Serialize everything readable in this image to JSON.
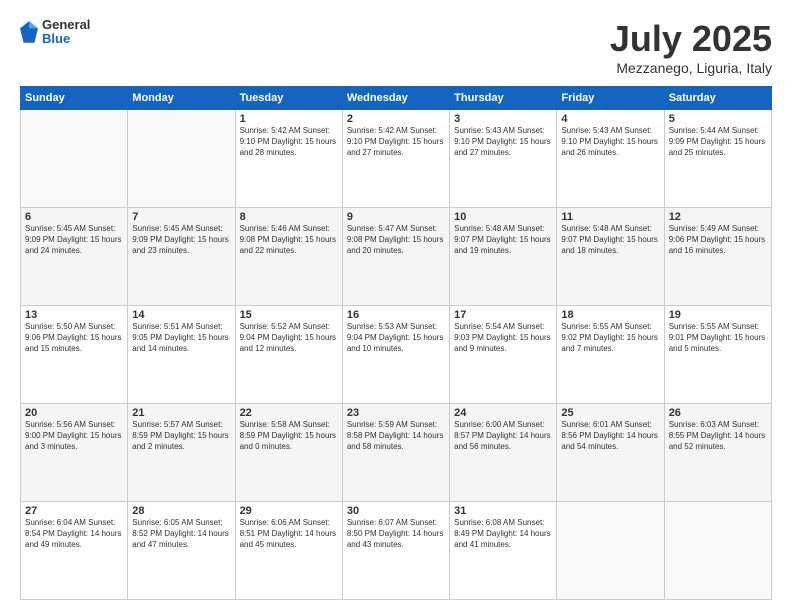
{
  "header": {
    "logo_general": "General",
    "logo_blue": "Blue",
    "title": "July 2025",
    "location": "Mezzanego, Liguria, Italy"
  },
  "days_of_week": [
    "Sunday",
    "Monday",
    "Tuesday",
    "Wednesday",
    "Thursday",
    "Friday",
    "Saturday"
  ],
  "weeks": [
    [
      {
        "day": "",
        "info": ""
      },
      {
        "day": "",
        "info": ""
      },
      {
        "day": "1",
        "info": "Sunrise: 5:42 AM\nSunset: 9:10 PM\nDaylight: 15 hours\nand 28 minutes."
      },
      {
        "day": "2",
        "info": "Sunrise: 5:42 AM\nSunset: 9:10 PM\nDaylight: 15 hours\nand 27 minutes."
      },
      {
        "day": "3",
        "info": "Sunrise: 5:43 AM\nSunset: 9:10 PM\nDaylight: 15 hours\nand 27 minutes."
      },
      {
        "day": "4",
        "info": "Sunrise: 5:43 AM\nSunset: 9:10 PM\nDaylight: 15 hours\nand 26 minutes."
      },
      {
        "day": "5",
        "info": "Sunrise: 5:44 AM\nSunset: 9:09 PM\nDaylight: 15 hours\nand 25 minutes."
      }
    ],
    [
      {
        "day": "6",
        "info": "Sunrise: 5:45 AM\nSunset: 9:09 PM\nDaylight: 15 hours\nand 24 minutes."
      },
      {
        "day": "7",
        "info": "Sunrise: 5:45 AM\nSunset: 9:09 PM\nDaylight: 15 hours\nand 23 minutes."
      },
      {
        "day": "8",
        "info": "Sunrise: 5:46 AM\nSunset: 9:08 PM\nDaylight: 15 hours\nand 22 minutes."
      },
      {
        "day": "9",
        "info": "Sunrise: 5:47 AM\nSunset: 9:08 PM\nDaylight: 15 hours\nand 20 minutes."
      },
      {
        "day": "10",
        "info": "Sunrise: 5:48 AM\nSunset: 9:07 PM\nDaylight: 15 hours\nand 19 minutes."
      },
      {
        "day": "11",
        "info": "Sunrise: 5:48 AM\nSunset: 9:07 PM\nDaylight: 15 hours\nand 18 minutes."
      },
      {
        "day": "12",
        "info": "Sunrise: 5:49 AM\nSunset: 9:06 PM\nDaylight: 15 hours\nand 16 minutes."
      }
    ],
    [
      {
        "day": "13",
        "info": "Sunrise: 5:50 AM\nSunset: 9:06 PM\nDaylight: 15 hours\nand 15 minutes."
      },
      {
        "day": "14",
        "info": "Sunrise: 5:51 AM\nSunset: 9:05 PM\nDaylight: 15 hours\nand 14 minutes."
      },
      {
        "day": "15",
        "info": "Sunrise: 5:52 AM\nSunset: 9:04 PM\nDaylight: 15 hours\nand 12 minutes."
      },
      {
        "day": "16",
        "info": "Sunrise: 5:53 AM\nSunset: 9:04 PM\nDaylight: 15 hours\nand 10 minutes."
      },
      {
        "day": "17",
        "info": "Sunrise: 5:54 AM\nSunset: 9:03 PM\nDaylight: 15 hours\nand 9 minutes."
      },
      {
        "day": "18",
        "info": "Sunrise: 5:55 AM\nSunset: 9:02 PM\nDaylight: 15 hours\nand 7 minutes."
      },
      {
        "day": "19",
        "info": "Sunrise: 5:55 AM\nSunset: 9:01 PM\nDaylight: 15 hours\nand 5 minutes."
      }
    ],
    [
      {
        "day": "20",
        "info": "Sunrise: 5:56 AM\nSunset: 9:00 PM\nDaylight: 15 hours\nand 3 minutes."
      },
      {
        "day": "21",
        "info": "Sunrise: 5:57 AM\nSunset: 8:59 PM\nDaylight: 15 hours\nand 2 minutes."
      },
      {
        "day": "22",
        "info": "Sunrise: 5:58 AM\nSunset: 8:59 PM\nDaylight: 15 hours\nand 0 minutes."
      },
      {
        "day": "23",
        "info": "Sunrise: 5:59 AM\nSunset: 8:58 PM\nDaylight: 14 hours\nand 58 minutes."
      },
      {
        "day": "24",
        "info": "Sunrise: 6:00 AM\nSunset: 8:57 PM\nDaylight: 14 hours\nand 56 minutes."
      },
      {
        "day": "25",
        "info": "Sunrise: 6:01 AM\nSunset: 8:56 PM\nDaylight: 14 hours\nand 54 minutes."
      },
      {
        "day": "26",
        "info": "Sunrise: 6:03 AM\nSunset: 8:55 PM\nDaylight: 14 hours\nand 52 minutes."
      }
    ],
    [
      {
        "day": "27",
        "info": "Sunrise: 6:04 AM\nSunset: 8:54 PM\nDaylight: 14 hours\nand 49 minutes."
      },
      {
        "day": "28",
        "info": "Sunrise: 6:05 AM\nSunset: 8:52 PM\nDaylight: 14 hours\nand 47 minutes."
      },
      {
        "day": "29",
        "info": "Sunrise: 6:06 AM\nSunset: 8:51 PM\nDaylight: 14 hours\nand 45 minutes."
      },
      {
        "day": "30",
        "info": "Sunrise: 6:07 AM\nSunset: 8:50 PM\nDaylight: 14 hours\nand 43 minutes."
      },
      {
        "day": "31",
        "info": "Sunrise: 6:08 AM\nSunset: 8:49 PM\nDaylight: 14 hours\nand 41 minutes."
      },
      {
        "day": "",
        "info": ""
      },
      {
        "day": "",
        "info": ""
      }
    ]
  ]
}
